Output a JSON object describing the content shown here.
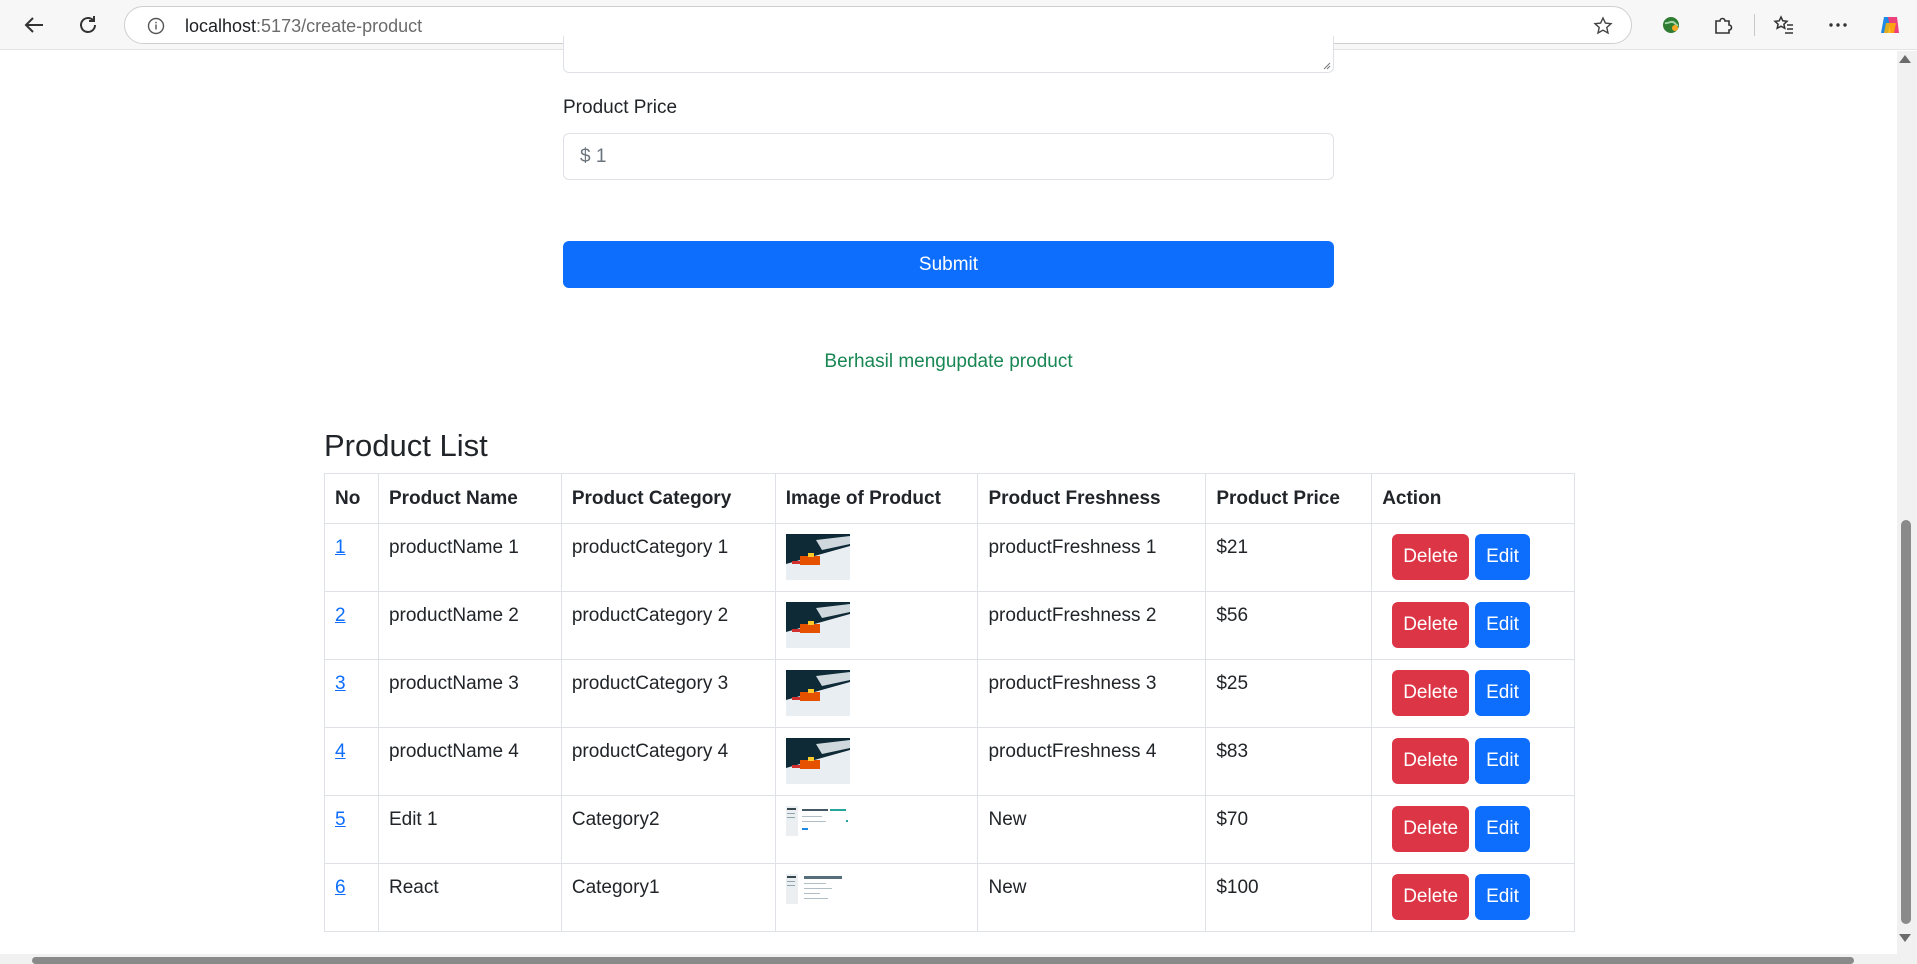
{
  "browser": {
    "url_host": "localhost",
    "url_rest": ":5173/create-product"
  },
  "form": {
    "price_label": "Product Price",
    "price_value": "$ 1",
    "submit_label": "Submit",
    "success_message": "Berhasil mengupdate product"
  },
  "list": {
    "title": "Product List",
    "headers": [
      "No",
      "Product Name",
      "Product Category",
      "Image of Product",
      "Product Freshness",
      "Product Price",
      "Action"
    ],
    "delete_label": "Delete",
    "edit_label": "Edit",
    "rows": [
      {
        "no": "1",
        "name": "productName 1",
        "category": "productCategory 1",
        "freshness": "productFreshness 1",
        "price": "$21",
        "image": "photo"
      },
      {
        "no": "2",
        "name": "productName 2",
        "category": "productCategory 2",
        "freshness": "productFreshness 2",
        "price": "$56",
        "image": "photo"
      },
      {
        "no": "3",
        "name": "productName 3",
        "category": "productCategory 3",
        "freshness": "productFreshness 3",
        "price": "$25",
        "image": "photo"
      },
      {
        "no": "4",
        "name": "productName 4",
        "category": "productCategory 4",
        "freshness": "productFreshness 4",
        "price": "$83",
        "image": "photo"
      },
      {
        "no": "5",
        "name": "Edit 1",
        "category": "Category2",
        "freshness": "New",
        "price": "$70",
        "image": "screenshot"
      },
      {
        "no": "6",
        "name": "React",
        "category": "Category1",
        "freshness": "New",
        "price": "$100",
        "image": "screenshot"
      }
    ]
  },
  "colors": {
    "primary": "#0d6efd",
    "danger": "#dc3545",
    "success": "#198754"
  }
}
